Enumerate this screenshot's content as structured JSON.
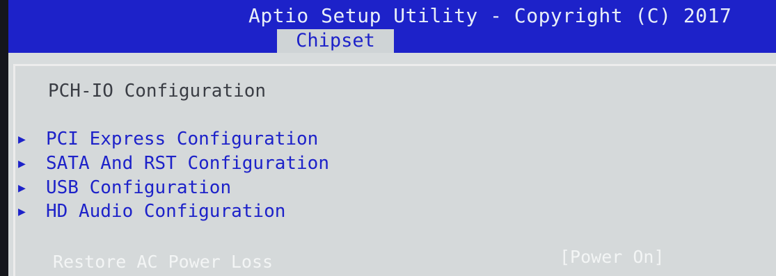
{
  "header": {
    "title": "Aptio Setup Utility - Copyright (C) 2017",
    "active_tab": "Chipset"
  },
  "panel": {
    "section_title": "PCH-IO Configuration",
    "menu_items": [
      {
        "label": "PCI Express Configuration",
        "arrow": "▶"
      },
      {
        "label": "SATA And RST Configuration",
        "arrow": "▶"
      },
      {
        "label": "USB Configuration",
        "arrow": "▶"
      },
      {
        "label": "HD Audio Configuration",
        "arrow": "▶"
      }
    ],
    "settings": [
      {
        "label": "Restore AC Power Loss",
        "value": "[Power On]"
      }
    ]
  },
  "colors": {
    "header_bg": "#1d22c9",
    "panel_bg": "#d5d9da",
    "menu_text": "#1d22c9",
    "highlight_text": "#f3f5f5"
  }
}
